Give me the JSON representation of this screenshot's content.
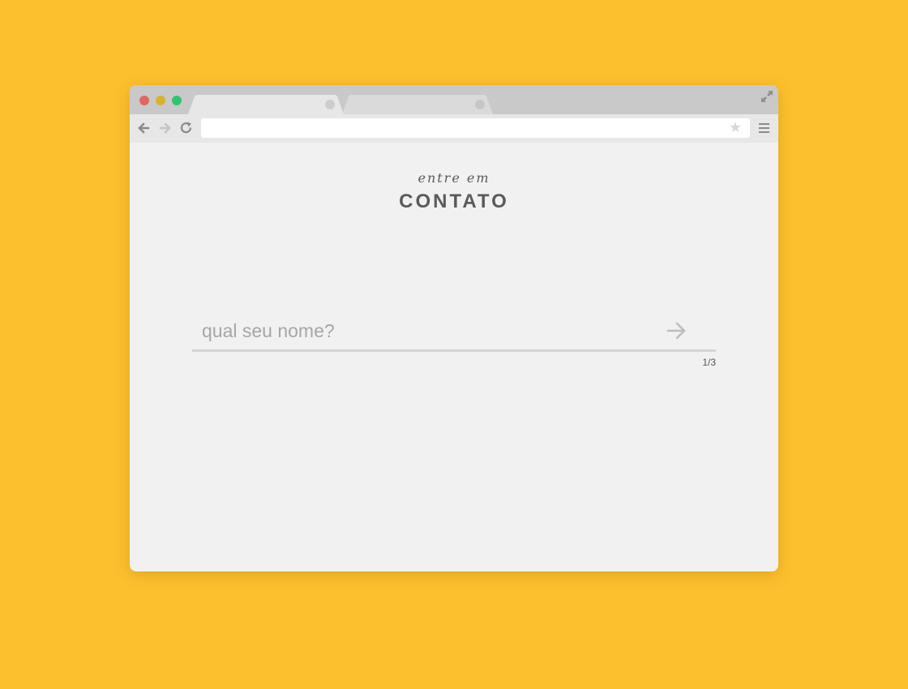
{
  "browser": {
    "tabs": [
      {
        "label": "",
        "active": true
      },
      {
        "label": "",
        "active": false
      }
    ],
    "address_bar": {
      "value": "",
      "placeholder": ""
    },
    "icons": {
      "back": "arrow-left-icon",
      "forward": "arrow-right-icon",
      "reload": "reload-icon",
      "bookmark": "star-icon",
      "menu": "hamburger-menu-icon",
      "fullscreen": "expand-icon"
    },
    "colors": {
      "close": "#E36662",
      "minimize": "#D8B12E",
      "maximize": "#2DC66E"
    }
  },
  "page": {
    "subtitle": "entre em",
    "title": "CONTATO",
    "form": {
      "name_placeholder": "qual seu nome?",
      "name_value": "",
      "step": "1/3",
      "step_current": 1,
      "step_total": 3
    },
    "background_color": "#FCC02E",
    "text_color": "#5A5A5A"
  }
}
